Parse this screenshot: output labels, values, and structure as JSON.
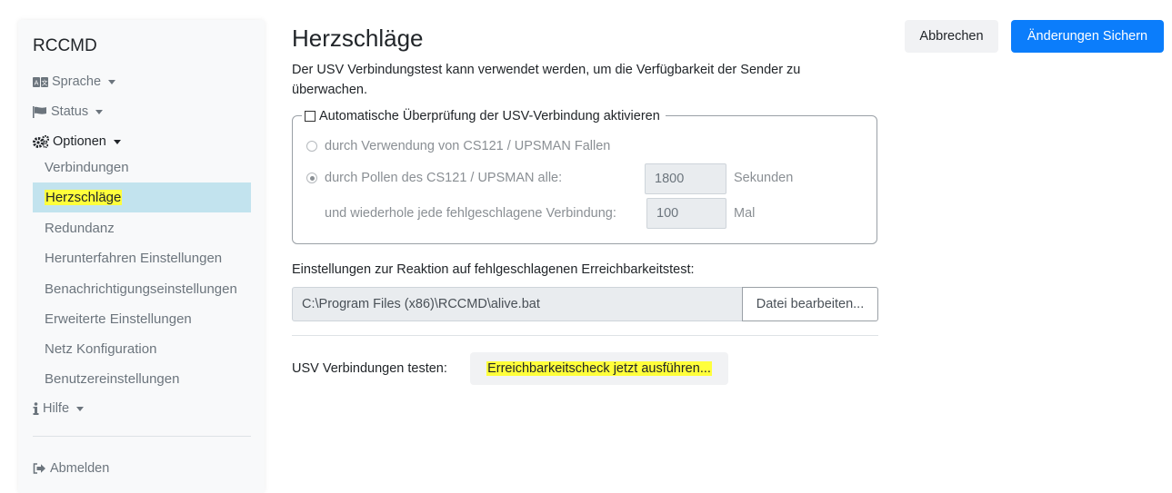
{
  "sidebar": {
    "brand": "RCCMD",
    "menu": [
      {
        "label": "Sprache",
        "icon": "language-icon"
      },
      {
        "label": "Status",
        "icon": "flag-icon"
      },
      {
        "label": "Optionen",
        "icon": "cogs-icon"
      }
    ],
    "options_items": [
      "Verbindungen",
      "Herzschläge",
      "Redundanz",
      "Herunterfahren Einstellungen",
      "Benachrichtigungseinstellungen",
      "Erweiterte Einstellungen",
      "Netz Konfiguration",
      "Benutzereinstellungen"
    ],
    "help": {
      "label": "Hilfe",
      "icon": "info-icon"
    },
    "logout": {
      "label": "Abmelden",
      "icon": "sign-out-icon"
    }
  },
  "header": {
    "title": "Herzschläge",
    "description": "Der USV Verbindungstest kann verwendet werden, um die Verfügbarkeit der Sender zu überwachen.",
    "cancel_label": "Abbrechen",
    "save_label": "Änderungen Sichern"
  },
  "check_group": {
    "legend": "Automatische Überprüfung der USV-Verbindung aktivieren",
    "checked": false,
    "option_traps": "durch Verwendung von CS121 / UPSMAN Fallen",
    "option_polling": "durch Pollen des CS121 / UPSMAN alle:",
    "poll_interval": "1800",
    "poll_unit": "Sekunden",
    "retry_label": "und wiederhole jede fehlgeschlagene Verbindung:",
    "retry_count": "100",
    "retry_unit": "Mal",
    "selected_option": "polling"
  },
  "reaction": {
    "label": "Einstellungen zur Reaktion auf fehlgeschlagenen Erreichbarkeitstest:",
    "file_path": "C:\\Program Files (x86)\\RCCMD\\alive.bat",
    "edit_button": "Datei bearbeiten..."
  },
  "test": {
    "label": "USV Verbindungen testen:",
    "button": "Erreichbarkeitscheck jetzt ausführen..."
  },
  "colors": {
    "primary": "#0b7dfb",
    "selected_bg": "#c2e3ee",
    "highlight": "#ffff3b"
  }
}
